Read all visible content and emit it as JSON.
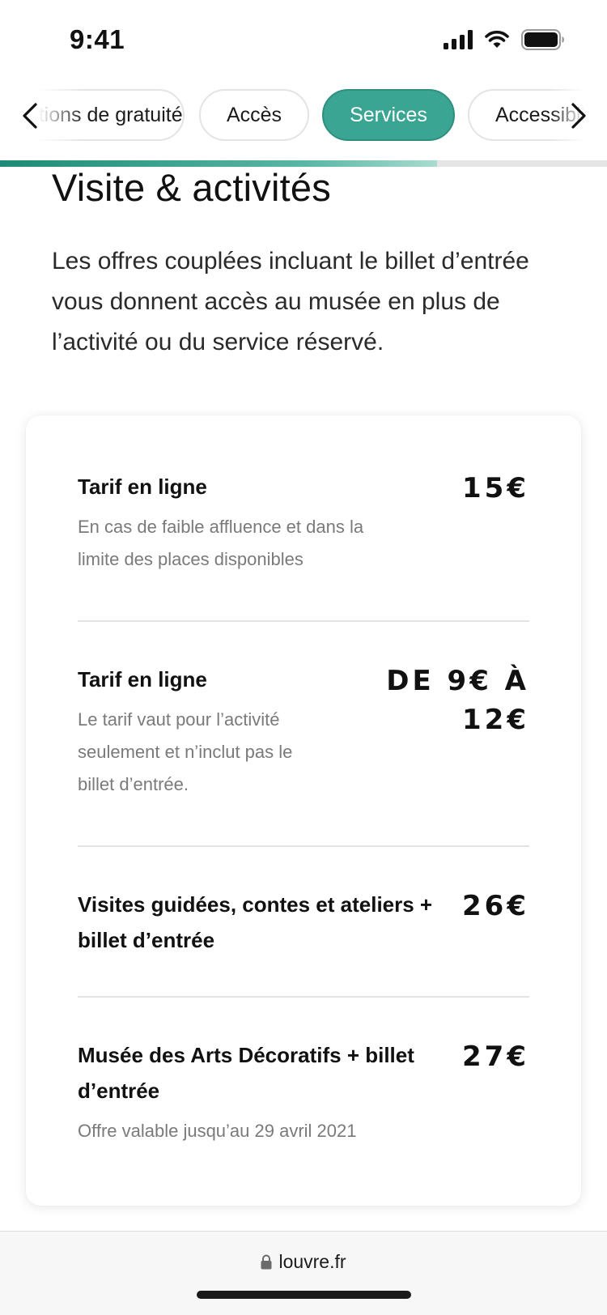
{
  "status_bar": {
    "time": "9:41",
    "icons": [
      "cellular-signal-icon",
      "wifi-icon",
      "battery-icon"
    ]
  },
  "tabs": {
    "items": [
      {
        "label": "Conditions de gratuité",
        "active": false
      },
      {
        "label": "Accès",
        "active": false
      },
      {
        "label": "Services",
        "active": true
      },
      {
        "label": "Accessibilité",
        "active": false
      }
    ],
    "prev_icon": "chevron-left-icon",
    "next_icon": "chevron-right-icon",
    "scroll_progress": 0.72
  },
  "section": {
    "title": "Visite & activités",
    "intro": "Les offres couplées incluant le billet d’entrée vous donnent accès au musée en plus de l’activité ou du service réservé."
  },
  "prices": [
    {
      "title": "Tarif en ligne",
      "note": "En cas de faible affluence et dans la limite des places disponibles",
      "price": "15€"
    },
    {
      "title": "Tarif en ligne",
      "note": "Le tarif vaut pour l’activité seulement et n’inclut pas le billet d’entrée.",
      "price": "De 9€ à 12€"
    },
    {
      "title": "Visites guidées, contes et ateliers + billet d’entrée",
      "note": "",
      "price": "26€"
    },
    {
      "title": "Musée des Arts Décoratifs + billet d’entrée",
      "note": "Offre valable jusqu’au 29 avril 2021",
      "price": "27€"
    }
  ],
  "browser": {
    "url": "louvre.fr",
    "lock_icon": "lock-icon"
  },
  "colors": {
    "accent": "#3aa592",
    "text": "#111111",
    "muted": "#7a7a7a"
  }
}
